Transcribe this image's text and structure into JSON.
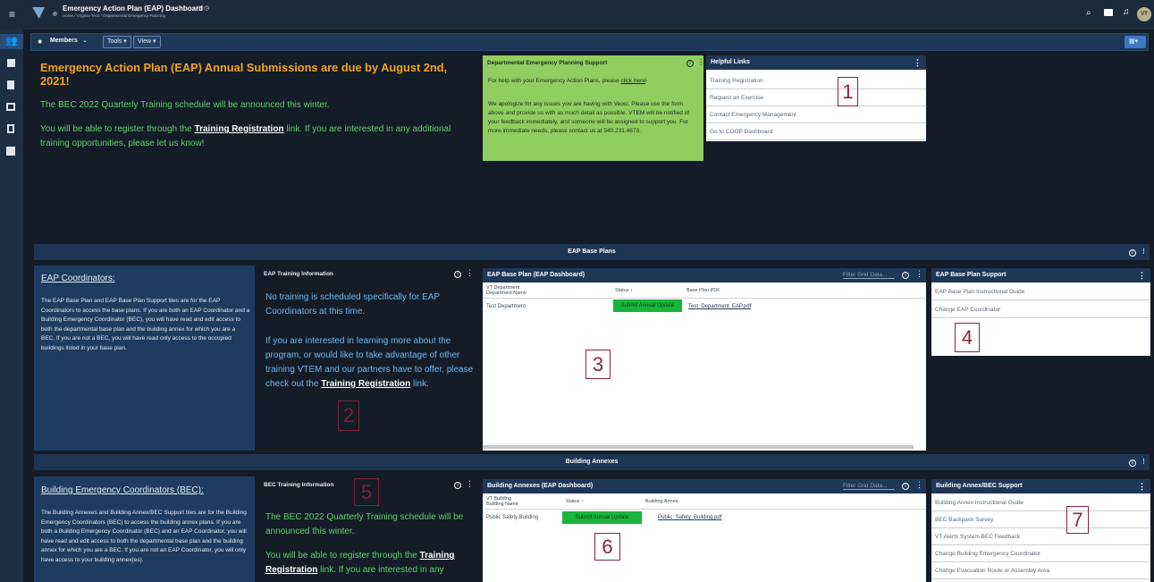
{
  "topbar": {
    "title": "Emergency Action Plan (EAP) Dashboard",
    "breadcrumb_home": "Home",
    "breadcrumb_org": "Virginia Tech",
    "breadcrumb_page": "Departmental Emergency Planning",
    "avatar": "VT"
  },
  "toolbar": {
    "members": "Members",
    "tools": "Tools",
    "view": "View"
  },
  "banner": {
    "headline": "Emergency Action Plan (EAP) Annual Submissions are due by August 2nd, 2021!",
    "line1": "The BEC 2022 Quarterly Training schedule will be announced this winter.",
    "line2a": "You will be able to register through the ",
    "line2link": "Training Registration",
    "line2b": " link. If you are interested in any additional training opportunities, please let us know!"
  },
  "support": {
    "title": "Departmental Emergency Planning Support",
    "p1a": "For help with your Emergency Action Plans, please ",
    "p1link": "click here",
    "p1b": "!",
    "p2": "We apologize for any issues you are having with Veoci.  Please use the form above and provide us with as much detail as possible.  VTEM will be notified of your feedback immediately, and someone will be assigned to support you.  For more immediate needs, please contact us at 540.231.4873."
  },
  "helpful": {
    "title": "Helpful Links",
    "links": [
      "Training Registration",
      "Request an Exercise",
      "Contact Emergency Management",
      "Go to COOP Dashboard"
    ]
  },
  "sections": {
    "base": "EAP Base Plans",
    "annex": "Building Annexes"
  },
  "coord": {
    "title": "EAP Coordinators:",
    "body": "The EAP Base Plan and EAP Base Plan Support tiles are for the EAP Coordinators to access the base plans. If you are both an EAP Coordinator and a Building Emergency Coordinator (BEC), you will have read and edit access to both the departmental base plan and the building annex for which you are a BEC. If you are not a BEC, you will have read only access to the occupied buildings listed in your base plan."
  },
  "training": {
    "title": "EAP Training Information",
    "p1": "No training is scheduled specifically for EAP Coordinators at this time.",
    "p2a": "If you are interested in learning more about the program, or would like to take advantage of other training VTEM and our partners have to offer, please check out the ",
    "p2link": "Training Registration",
    "p2b": " link."
  },
  "baseplan": {
    "title": "EAP Base Plan (EAP Dashboard)",
    "filter": "Filter Grid Data...",
    "col1a": "VT Department",
    "col1b": "Department Name",
    "col2": "Status",
    "col3": "Base Plan PDF",
    "row_name": "Test Department",
    "row_status": "Submit Annual Update",
    "row_pdf": "Test_Department_EAP.pdf"
  },
  "basesupport": {
    "title": "EAP Base Plan Support",
    "links": [
      "EAP Base Plan Instructional Guide",
      "Change EAP Coordinator"
    ]
  },
  "bec": {
    "title": "Building Emergency Coordinators (BEC):",
    "body": "The Building Annexes and Building Annex/BEC Support tiles are for the Building Emergency Coordinators (BEC) to access the building annex plans. If you are both a Building Emergency Coordinator (BEC) and an EAP Coordinator, you will have read and edit access to both the departmental base plan and the building annex for which you are a BEC. If you are not an EAP Coordinator, you will only have access to your building annex(es)."
  },
  "bectraining": {
    "title": "BEC Training Information",
    "p1": "The BEC 2022 Quarterly Training schedule will be announced this winter.",
    "p2a": "You will be able to register through the ",
    "p2link": "Training Registration",
    "p2b": " link. If you are interested in any"
  },
  "annexes": {
    "title": "Building Annexes (EAP Dashboard)",
    "filter": "Filter Grid Data...",
    "col1a": "VT Building",
    "col1b": "Building Name",
    "col2": "Status",
    "col3": "Building Annex",
    "row_name": "Public Safety Building",
    "row_status": "Submit Annual Update",
    "row_pdf": "Public_Safety_Building.pdf"
  },
  "annexsupport": {
    "title": "Building Annex/BEC Support",
    "links": [
      "Building Annex Instructional Guide",
      "BEC Backpack Survey",
      "VT Alerts System BEC Feedback",
      "Change Building Emergency Coordinator",
      "Change Evacuation Route or Assembly Area"
    ]
  },
  "annotations": [
    "1",
    "2",
    "3",
    "4",
    "5",
    "6",
    "7"
  ],
  "colors": {
    "accent_orange": "#f5a21a",
    "text_green": "#62d26a",
    "support_green": "#8fce5f",
    "status_green": "#19b43b",
    "annotation": "#8c2339"
  }
}
